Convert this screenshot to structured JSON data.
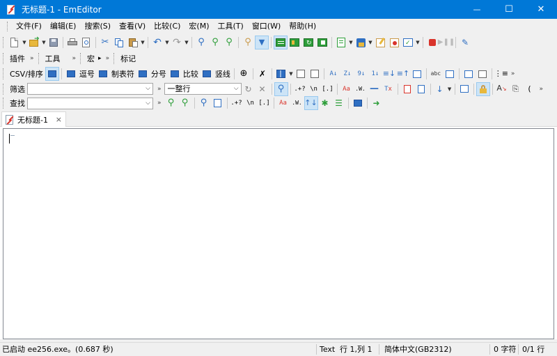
{
  "window": {
    "title": "无标题-1 - EmEditor",
    "minimize": "—",
    "maximize": "☐",
    "close": "✕"
  },
  "menu": [
    "文件(F)",
    "编辑(E)",
    "搜索(S)",
    "查看(V)",
    "比较(C)",
    "宏(M)",
    "工具(T)",
    "窗口(W)",
    "帮助(H)"
  ],
  "toolbar2": {
    "plugins_label": "插件",
    "tools_label": "工具",
    "macros_label": "宏",
    "macros_extra": "▸",
    "bookmarks_label": "标记"
  },
  "csv_toolbar": {
    "label": "CSV/排序",
    "buttons": [
      "逗号",
      "制表符",
      "分号",
      "比较",
      "竖线"
    ],
    "sort_labels": [
      "A↓",
      "Z↓",
      "9↓",
      "1↓"
    ]
  },
  "filter_toolbar": {
    "label": "筛选",
    "filter_value": "",
    "mode_value": "一整行",
    "regex_label": ".+?",
    "newline_label": "\\n",
    "bracket_label": "[.]",
    "case_label": "Aa",
    "word_label": ".W."
  },
  "find_toolbar": {
    "label": "查找",
    "find_value": "",
    "regex_label": ".+?",
    "newline_label": "\\n",
    "bracket_label": "[.]",
    "case_label": "Aa",
    "word_label": ".W."
  },
  "tab": {
    "label": "无标题-1",
    "close": "×"
  },
  "editor": {
    "content": ""
  },
  "statusbar": {
    "message": "已启动 ee256.exe。(0.687 秒)",
    "mode": "Text",
    "position": "行 1,列 1",
    "encoding": "简体中文(GB2312)",
    "chars": "0 字符",
    "lines": "0/1 行"
  },
  "colors": {
    "titlebar": "#0078d7",
    "chrome": "#f0f0f0",
    "pressed": "#cce4f7",
    "accent_red": "#d9342b",
    "accent_green": "#2e9e3a",
    "accent_blue": "#2f6fc2"
  }
}
